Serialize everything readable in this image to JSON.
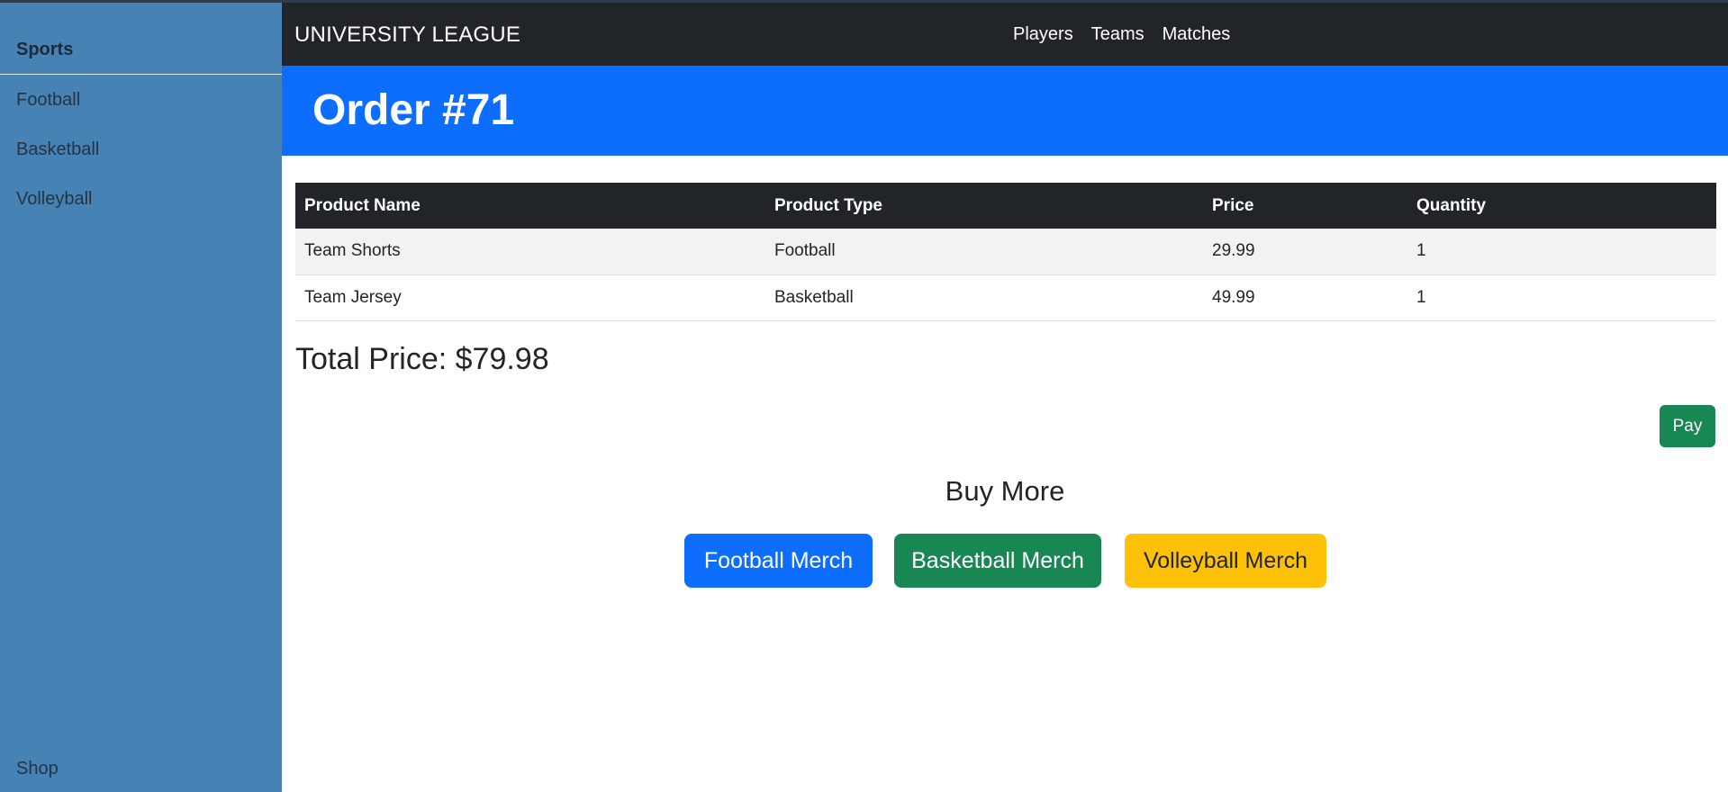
{
  "navbar": {
    "brand": "UNIVERSITY LEAGUE",
    "links": [
      "Players",
      "Teams",
      "Matches"
    ]
  },
  "sidebar": {
    "title": "Sports",
    "items": [
      "Football",
      "Basketball",
      "Volleyball"
    ],
    "shop": "Shop"
  },
  "header": {
    "title": "Order #71"
  },
  "table": {
    "columns": [
      "Product Name",
      "Product Type",
      "Price",
      "Quantity"
    ],
    "rows": [
      [
        "Team Shorts",
        "Football",
        "29.99",
        "1"
      ],
      [
        "Team Jersey",
        "Basketball",
        "49.99",
        "1"
      ]
    ]
  },
  "total": "Total Price: $79.98",
  "pay_label": "Pay",
  "buy_more": {
    "title": "Buy More",
    "buttons": [
      "Football Merch",
      "Basketball Merch",
      "Volleyball Merch"
    ]
  },
  "colors": {
    "sidebar": "#4682b4",
    "navbar": "#212529",
    "header": "#0d6efd",
    "success": "#198754",
    "warning": "#ffc107"
  }
}
